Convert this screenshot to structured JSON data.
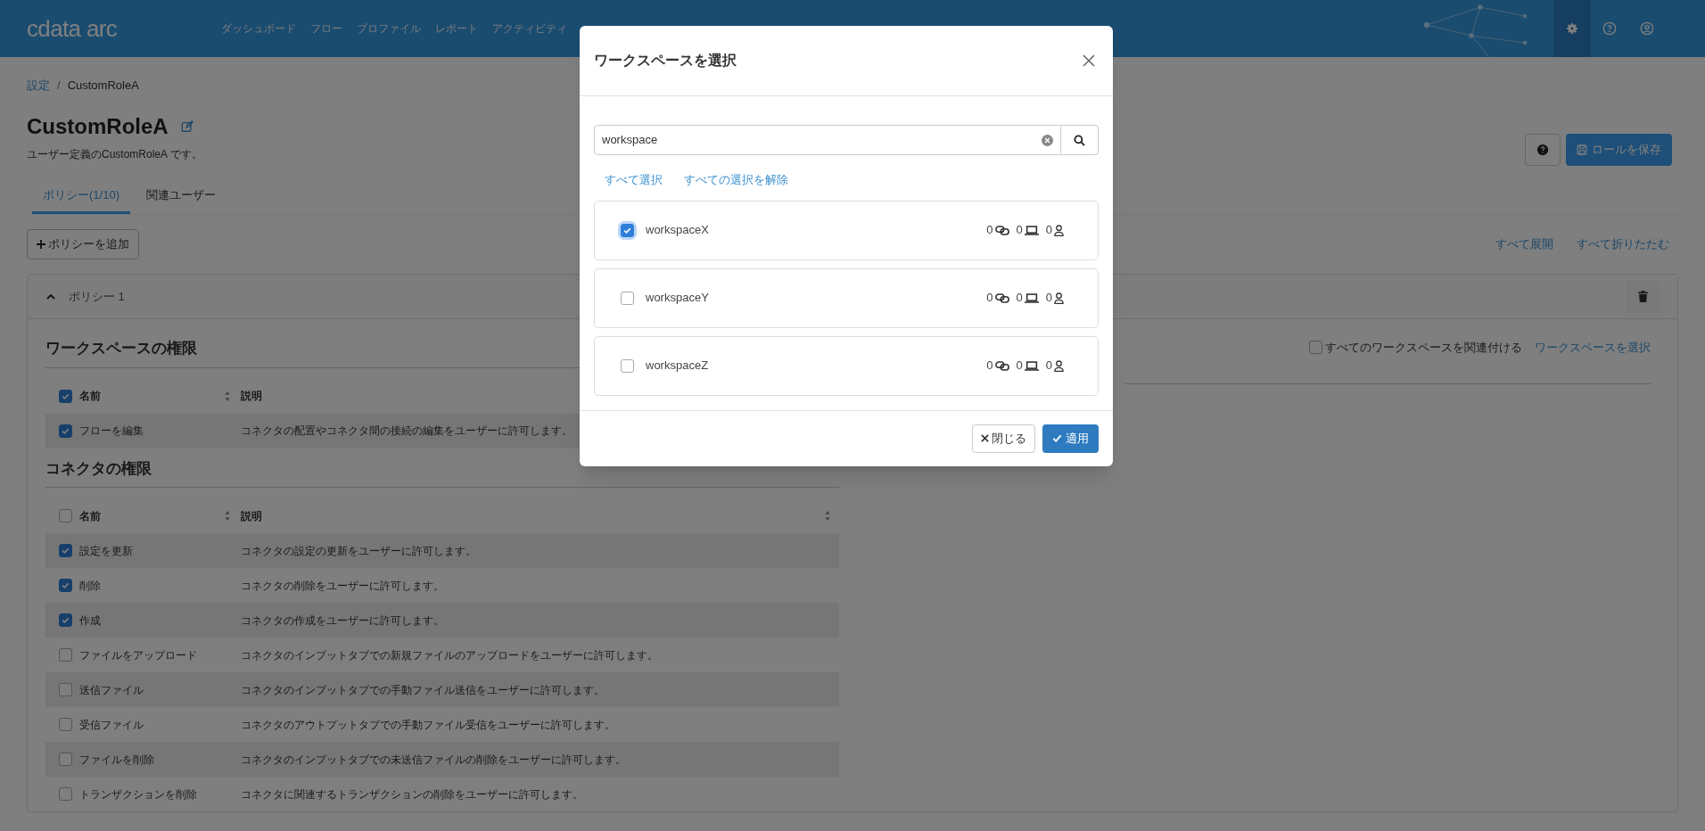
{
  "header": {
    "logo": "cdata arc",
    "nav": [
      "ダッシュボード",
      "フロー",
      "プロファイル",
      "レポート",
      "アクティビティ"
    ],
    "actions": [
      {
        "kind": "settings",
        "selected": true
      },
      {
        "kind": "help",
        "selected": false
      },
      {
        "kind": "user",
        "selected": false
      }
    ]
  },
  "breadcrumb": [
    "設定",
    "CustomRoleA"
  ],
  "breadcrumb_separator": "/",
  "role_title": "CustomRoleA",
  "role_description": "ユーザー定義のCustomRoleA です。",
  "save_button": "ロールを保存",
  "tabs": [
    {
      "label": "ポリシー(1/10)",
      "selected": true
    },
    {
      "label": "関連ユーザー",
      "selected": false
    }
  ],
  "add_policy_button": "ポリシーを追加",
  "expand_all": "すべて展開",
  "collapse_all": "すべて折りたたむ",
  "policy": {
    "title": "ポリシー 1",
    "expanded": true,
    "associate_all": {
      "label": "すべてのワークスペースを関連付ける",
      "checked": false
    },
    "select_workspace_link": "ワークスペースを選択",
    "sections": [
      {
        "title": "ワークスペースの権限",
        "columns": [
          "名前",
          "説明"
        ],
        "header_checked": true,
        "rows": [
          {
            "name": "フローを編集",
            "description": "コネクタの配置やコネクタ間の接続の編集をユーザーに許可します。",
            "checked": true
          }
        ]
      },
      {
        "title": "コネクタの権限",
        "columns": [
          "名前",
          "説明"
        ],
        "header_checked": false,
        "rows": [
          {
            "name": "設定を更新",
            "description": "コネクタの設定の更新をユーザーに許可します。",
            "checked": true
          },
          {
            "name": "削除",
            "description": "コネクタの削除をユーザーに許可します。",
            "checked": true
          },
          {
            "name": "作成",
            "description": "コネクタの作成をユーザーに許可します。",
            "checked": true
          },
          {
            "name": "ファイルをアップロード",
            "description": "コネクタのインプットタブでの新規ファイルのアップロードをユーザーに許可します。",
            "checked": false
          },
          {
            "name": "送信ファイル",
            "description": "コネクタのインプットタブでの手動ファイル送信をユーザーに許可します。",
            "checked": false
          },
          {
            "name": "受信ファイル",
            "description": "コネクタのアウトプットタブでの手動ファイル受信をユーザーに許可します。",
            "checked": false
          },
          {
            "name": "ファイルを削除",
            "description": "コネクタのインプットタブでの未送信ファイルの削除をユーザーに許可します。",
            "checked": false
          },
          {
            "name": "トランザクションを削除",
            "description": "コネクタに関連するトランザクションの削除をユーザーに許可します。",
            "checked": false
          }
        ]
      }
    ]
  },
  "modal": {
    "title": "ワークスペースを選択",
    "search_value": "workspace",
    "select_all": "すべて選択",
    "deselect_all": "すべての選択を解除",
    "workspaces": [
      {
        "name": "workspaceX",
        "checked": true,
        "connections": "0",
        "connectors": "0",
        "users": "0"
      },
      {
        "name": "workspaceY",
        "checked": false,
        "connections": "0",
        "connectors": "0",
        "users": "0"
      },
      {
        "name": "workspaceZ",
        "checked": false,
        "connections": "0",
        "connectors": "0",
        "users": "0"
      }
    ],
    "close_button": "閉じる",
    "apply_button": "適用"
  }
}
